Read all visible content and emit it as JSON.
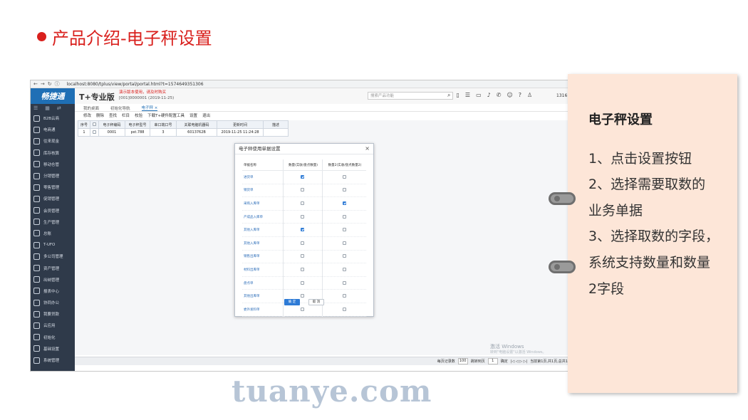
{
  "slide": {
    "title": "产品介绍-电子秤设置",
    "accent_color": "#d9201d"
  },
  "browser": {
    "url": "localhost:8080/tplus/view/portal/portal.html?t=1574649351306"
  },
  "app": {
    "logo_text": "畅捷通",
    "brand": "T+专业版",
    "notice": "演示版本使用，请及时购买",
    "account": "[001]0000001",
    "date": "(2019-11-25)",
    "search_placeholder": "搜索产品功能",
    "user_code": "1316"
  },
  "sidebar": {
    "items": [
      {
        "label": "B2B云商"
      },
      {
        "label": "电商通"
      },
      {
        "label": "往来现金"
      },
      {
        "label": "库存核算"
      },
      {
        "label": "移动仓管"
      },
      {
        "label": "分销管理"
      },
      {
        "label": "零售管理"
      },
      {
        "label": "促销管理"
      },
      {
        "label": "会员管理"
      },
      {
        "label": "生产管理"
      },
      {
        "label": "总账"
      },
      {
        "label": "T-UFO"
      },
      {
        "label": "多公司管理"
      },
      {
        "label": "资产管理"
      },
      {
        "label": "出纳管理"
      },
      {
        "label": "报表中心"
      },
      {
        "label": "协同办公"
      },
      {
        "label": "我要贷款"
      },
      {
        "label": "云应用"
      },
      {
        "label": "初始化"
      },
      {
        "label": "基础设置"
      },
      {
        "label": "系统管理"
      }
    ]
  },
  "tabs": [
    {
      "label": "我的桌面"
    },
    {
      "label": "初始化导航"
    },
    {
      "label": "电子秤 ×"
    }
  ],
  "toolbar": [
    {
      "label": "修改"
    },
    {
      "label": "删除"
    },
    {
      "label": "查找"
    },
    {
      "label": "栏目"
    },
    {
      "label": "校验"
    },
    {
      "label": "下载T+硬件配置工具"
    },
    {
      "label": "设置"
    },
    {
      "label": "退出"
    }
  ],
  "grid": {
    "headers": [
      "序号",
      "",
      "电子秤编码",
      "电子秤型号",
      "串口端口号",
      "关联电脑机器码",
      "更新时间",
      "描述"
    ],
    "row": [
      "1",
      "",
      "0001",
      "pst.788",
      "3",
      "6013762B",
      "2019-11-25 11:24:28",
      ""
    ]
  },
  "modal": {
    "title": "电子秤使用单据设置",
    "close": "×",
    "col_doc": "单据名称",
    "col_qty1": "数量(实收/盘点数量)",
    "col_qty2": "数量2(实收/盘点数量2)",
    "rows": [
      {
        "name": "进货单",
        "qty1": true,
        "qty2": false
      },
      {
        "name": "销货单",
        "qty1": false,
        "qty2": false
      },
      {
        "name": "采购入库单",
        "qty1": false,
        "qty2": true
      },
      {
        "name": "产成品入库单",
        "qty1": false,
        "qty2": false
      },
      {
        "name": "其他入库单",
        "qty1": true,
        "qty2": false
      },
      {
        "name": "其他入库单",
        "qty1": false,
        "qty2": false
      },
      {
        "name": "销售出库单",
        "qty1": false,
        "qty2": false
      },
      {
        "name": "材料出库单",
        "qty1": false,
        "qty2": false
      },
      {
        "name": "盘点单",
        "qty1": false,
        "qty2": false
      },
      {
        "name": "其他出库单",
        "qty1": false,
        "qty2": false
      },
      {
        "name": "委外发料单",
        "qty1": false,
        "qty2": false
      }
    ],
    "ok": "确 定",
    "cancel": "取 消"
  },
  "status_bar": {
    "page_size_label": "每页记录数",
    "page_size": "100",
    "goto_label": "跳转到页",
    "goto_page": "1",
    "confirm": "确定",
    "nav": "|◁ ◁ ▷ ▷|",
    "summary": "当前第1页,共1页,总共1"
  },
  "windows_watermark": {
    "line1": "激活 Windows",
    "line2": "转到\"电脑设置\"以激活 Windows。"
  },
  "note": {
    "title": "电子秤设置",
    "lines": [
      "1、点击设置按钮",
      "2、选择需要取数的",
      "业务单据",
      "3、选择取数的字段，",
      "系统支持数量和数量",
      "2字段"
    ],
    "bg_color": "#fde6d8"
  },
  "watermark": "tuanye.com"
}
